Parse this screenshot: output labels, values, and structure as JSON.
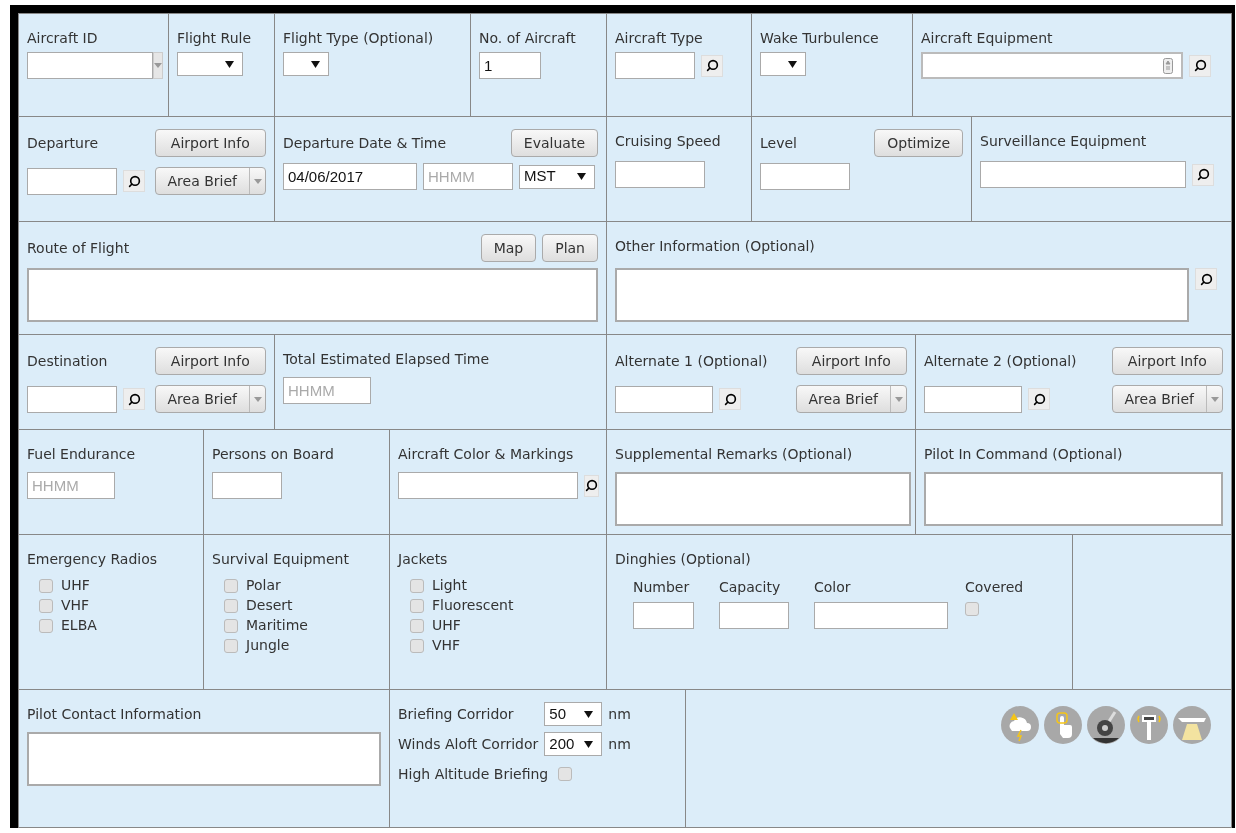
{
  "aircraft_id": {
    "label": "Aircraft ID"
  },
  "flight_rule": {
    "label": "Flight Rule"
  },
  "flight_type": {
    "label": "Flight Type (Optional)"
  },
  "number_of_aircraft": {
    "label": "No. of Aircraft",
    "value": "1"
  },
  "aircraft_type": {
    "label": "Aircraft Type"
  },
  "wake_turbulence": {
    "label": "Wake Turbulence"
  },
  "aircraft_equipment": {
    "label": "Aircraft Equipment"
  },
  "departure": {
    "label": "Departure",
    "info_button": "Airport Info",
    "brief_button": "Area Brief"
  },
  "departure_time": {
    "label": "Departure Date & Time",
    "button": "Evaluate",
    "date": "04/06/2017",
    "time_placeholder": "HHMM",
    "time_zone": "MST"
  },
  "cruising_speed": {
    "label": "Cruising Speed"
  },
  "level": {
    "label": "Level",
    "button": "Optimize"
  },
  "surveillance_equipment": {
    "label": "Surveillance Equipment"
  },
  "route_of_flight": {
    "label": "Route of Flight",
    "buttons": [
      "Map",
      "Plan"
    ]
  },
  "other_information": {
    "label": "Other Information (Optional)"
  },
  "destination": {
    "label": "Destination",
    "info_button": "Airport Info",
    "brief_button": "Area Brief"
  },
  "total_estimated_elapsed_time": {
    "label": "Total Estimated Elapsed Time",
    "placeholder": "HHMM"
  },
  "alternate_1": {
    "label": "Alternate 1 (Optional)",
    "info_button": "Airport Info",
    "brief_button": "Area Brief"
  },
  "alternate_2": {
    "label": "Alternate 2 (Optional)",
    "info_button": "Airport Info",
    "brief_button": "Area Brief"
  },
  "fuel_endurance": {
    "label": "Fuel Endurance",
    "placeholder": "HHMM"
  },
  "persons_on_board": {
    "label": "Persons on Board"
  },
  "aircraft_color_markings": {
    "label": "Aircraft Color & Markings"
  },
  "supplemental_remarks": {
    "label": "Supplemental Remarks (Optional)"
  },
  "pilot_in_command": {
    "label": "Pilot In Command (Optional)"
  },
  "emergency_radios": {
    "label": "Emergency Radios",
    "options": [
      {
        "label": "UHF",
        "checked": false
      },
      {
        "label": "VHF",
        "checked": false
      },
      {
        "label": "ELBA",
        "checked": false
      }
    ]
  },
  "survival_equipment": {
    "label": "Survival Equipment",
    "options": [
      {
        "label": "Polar",
        "checked": false
      },
      {
        "label": "Desert",
        "checked": false
      },
      {
        "label": "Maritime",
        "checked": false
      },
      {
        "label": "Jungle",
        "checked": false
      }
    ]
  },
  "jackets": {
    "label": "Jackets",
    "options": [
      {
        "label": "Light",
        "checked": false
      },
      {
        "label": "Fluorescent",
        "checked": false
      },
      {
        "label": "UHF",
        "checked": false
      },
      {
        "label": "VHF",
        "checked": false
      }
    ]
  },
  "dinghies": {
    "label": "Dinghies (Optional)",
    "fields": [
      "Number",
      "Capacity",
      "Color"
    ],
    "covered": {
      "label": "Covered",
      "checked": false
    }
  },
  "pilot_contact": {
    "label": "Pilot Contact Information"
  },
  "briefing": {
    "corridor": {
      "label": "Briefing Corridor",
      "value": "50",
      "unit": "nm"
    },
    "winds_aloft": {
      "label": "Winds Aloft Corridor",
      "value": "200",
      "unit": "nm"
    },
    "high_altitude": {
      "label": "High Altitude Briefing",
      "checked": false
    }
  }
}
